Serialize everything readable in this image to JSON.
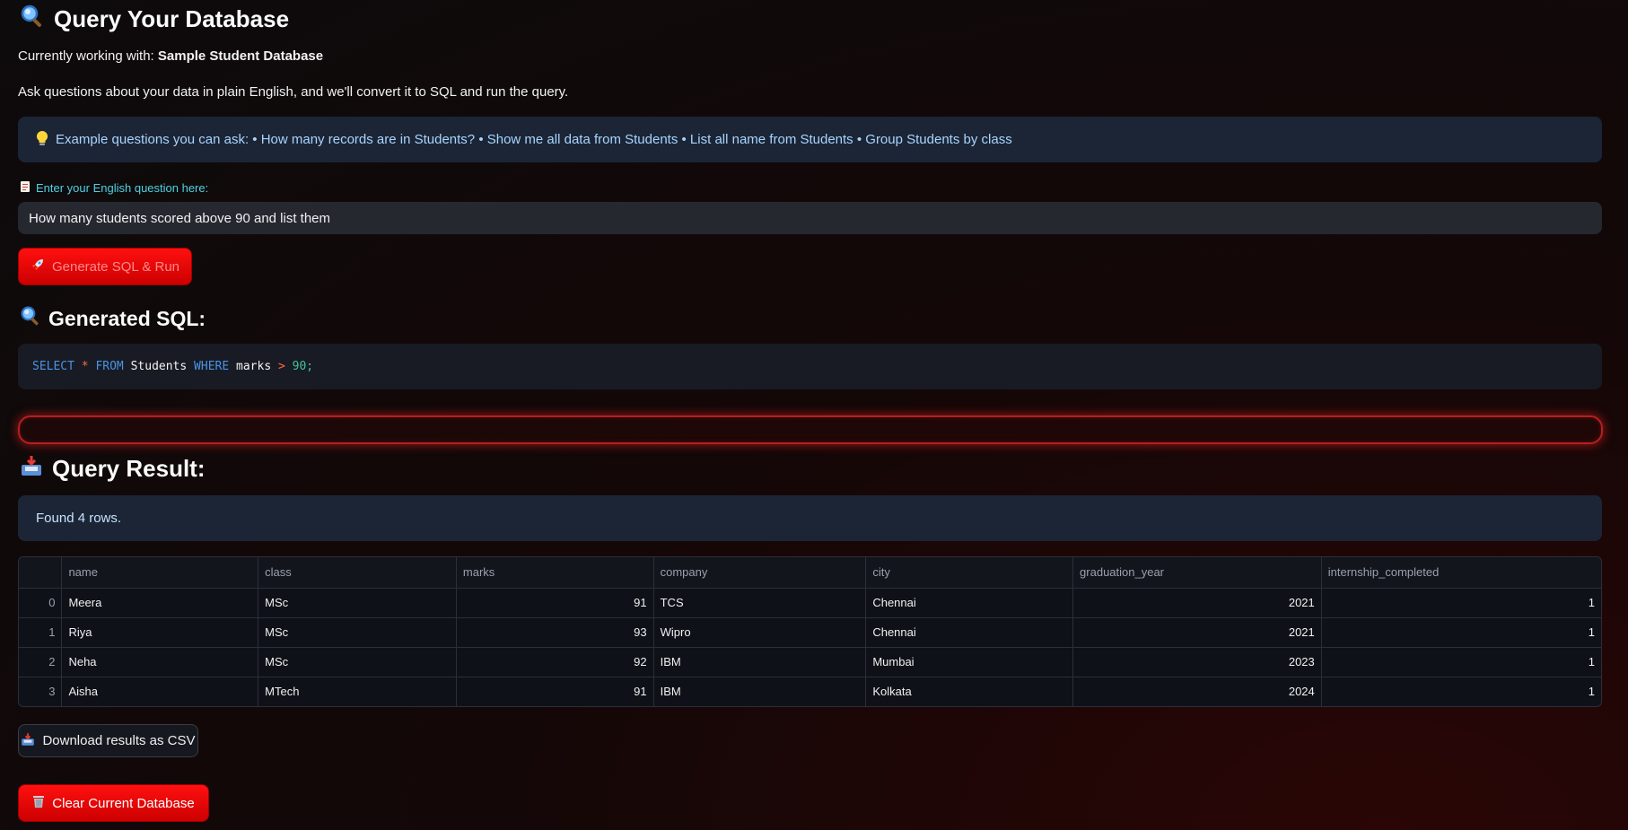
{
  "header": {
    "icon": "magnifier-icon",
    "title": "Query Your Database"
  },
  "working": {
    "prefix": "Currently working with: ",
    "db_name": "Sample Student Database"
  },
  "intro": "Ask questions about your data in plain English, and we'll convert it to SQL and run the query.",
  "examples": {
    "icon": "lightbulb-icon",
    "text": "Example questions you can ask: • How many records are in Students? • Show me all data from Students • List all name from Students • Group Students by class"
  },
  "question": {
    "icon": "memo-icon",
    "label": "Enter your English question here:",
    "value": "How many students scored above 90 and list them"
  },
  "generate_button": {
    "icon": "rocket-icon",
    "label": "Generate SQL & Run"
  },
  "generated_sql": {
    "icon": "magnifier-icon",
    "title": "Generated SQL:",
    "code": "SELECT * FROM Students WHERE marks > 90;"
  },
  "result": {
    "icon": "inbox-tray-icon",
    "title": "Query Result:",
    "status": "Found 4 rows.",
    "columns": [
      "",
      "name",
      "class",
      "marks",
      "company",
      "city",
      "graduation_year",
      "internship_completed"
    ],
    "rows": [
      [
        "0",
        "Meera",
        "MSc",
        "91",
        "TCS",
        "Chennai",
        "2021",
        "1"
      ],
      [
        "1",
        "Riya",
        "MSc",
        "93",
        "Wipro",
        "Chennai",
        "2021",
        "1"
      ],
      [
        "2",
        "Neha",
        "MSc",
        "92",
        "IBM",
        "Mumbai",
        "2023",
        "1"
      ],
      [
        "3",
        "Aisha",
        "MTech",
        "91",
        "IBM",
        "Kolkata",
        "2024",
        "1"
      ]
    ]
  },
  "download_button": {
    "icon": "inbox-tray-icon",
    "label": "Download results as CSV"
  },
  "clear_button": {
    "icon": "wastebasket-icon",
    "label": "Clear Current Database"
  },
  "colors": {
    "accent_red": "#ff1010",
    "info_bg": "#1b2535",
    "label_cyan": "#4fd1e3"
  }
}
